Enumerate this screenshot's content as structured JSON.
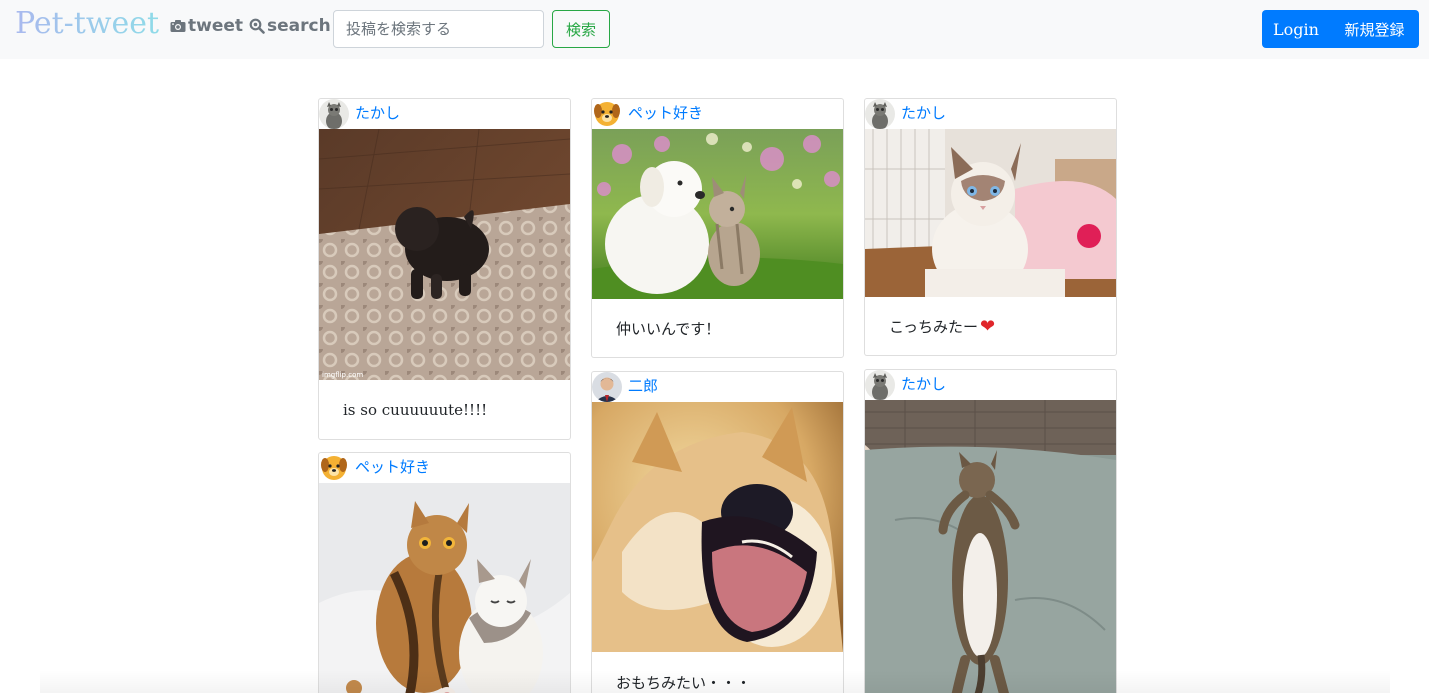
{
  "navbar": {
    "brand": "Pet-tweet",
    "tweet_label": "tweet",
    "search_label": "search",
    "search_placeholder": "投稿を検索する",
    "search_button": "検索",
    "login": "Login",
    "signup": "新規登録"
  },
  "posts": [
    {
      "user": "たかし",
      "caption": "is so cuuuuuute!!!!",
      "avatar": "raccoon-statue-avatar",
      "photo_watermark": "imgflip.com"
    },
    {
      "user": "ペット好き",
      "caption": "",
      "avatar": "dog-face-avatar"
    },
    {
      "user": "ペット好き",
      "caption": "仲いいんです！",
      "avatar": "dog-face-avatar"
    },
    {
      "user": "二郎",
      "caption": "おもちみたい・・・",
      "avatar": "man-portrait-avatar"
    },
    {
      "user": "たかし",
      "caption": "こっちみたー",
      "avatar": "raccoon-statue-avatar"
    },
    {
      "user": "たかし",
      "caption": "",
      "avatar": "raccoon-statue-avatar"
    }
  ],
  "colors": {
    "brand_from": "#a9b9ee",
    "brand_to": "#8fdbe8",
    "link": "#007bff",
    "success": "#28a745",
    "primary": "#007bff"
  }
}
